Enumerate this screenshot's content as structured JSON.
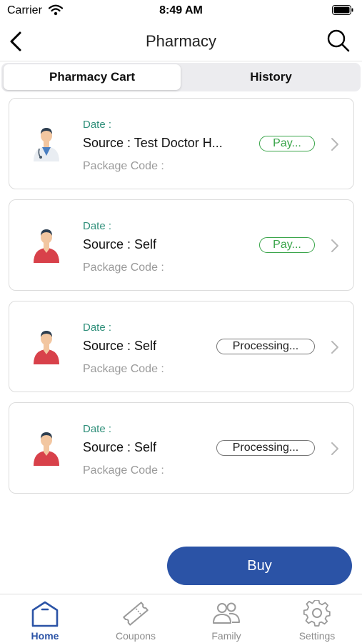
{
  "status_bar": {
    "carrier": "Carrier",
    "time": "8:49 AM"
  },
  "nav": {
    "title": "Pharmacy"
  },
  "segments": [
    {
      "label": "Pharmacy Cart",
      "selected": true
    },
    {
      "label": "History",
      "selected": false
    }
  ],
  "orders": [
    {
      "date_label": "Date :",
      "source": "Source : Test Doctor H...",
      "status": "Pay...",
      "package_code_label": "Package Code :",
      "avatar": "doctor-avatar-icon"
    },
    {
      "date_label": "Date :",
      "source": "Source : Self",
      "status": "Pay...",
      "package_code_label": "Package Code :",
      "avatar": "patient-avatar-icon"
    },
    {
      "date_label": "Date :",
      "source": "Source : Self",
      "status": "Processing...",
      "package_code_label": "Package Code :",
      "avatar": "patient-avatar-icon"
    },
    {
      "date_label": "Date :",
      "source": "Source : Self",
      "status": "Processing...",
      "package_code_label": "Package Code :",
      "avatar": "patient-avatar-icon"
    }
  ],
  "buy_button": {
    "label": "Buy"
  },
  "tab_bar": [
    {
      "label": "Home",
      "icon": "home-icon",
      "active": true
    },
    {
      "label": "Coupons",
      "icon": "coupon-icon",
      "active": false
    },
    {
      "label": "Family",
      "icon": "family-icon",
      "active": false
    },
    {
      "label": "Settings",
      "icon": "settings-icon",
      "active": false
    }
  ],
  "colors": {
    "accent": "#2b53a6",
    "pay_status": "#3aa54a",
    "date_label": "#2f8f7a"
  }
}
